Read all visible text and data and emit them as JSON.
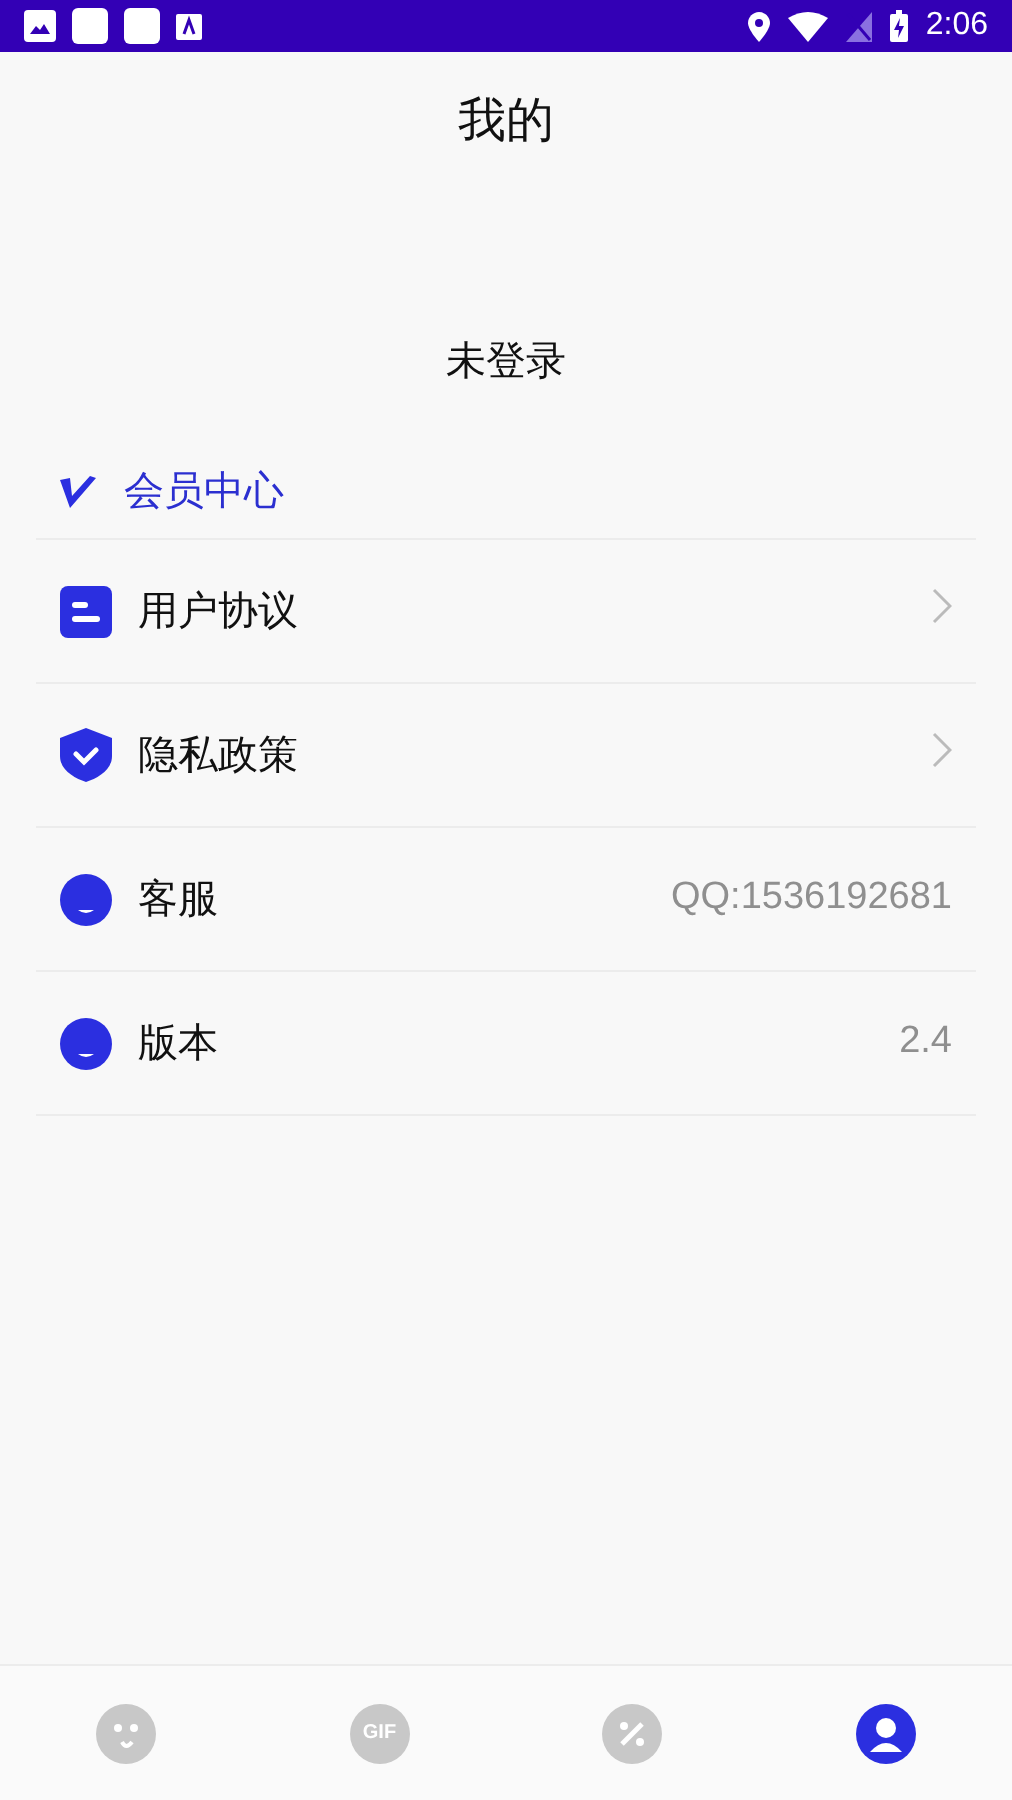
{
  "status_bar": {
    "time": "2:06"
  },
  "header": {
    "title": "我的"
  },
  "profile": {
    "login_status": "未登录"
  },
  "member": {
    "label": "会员中心"
  },
  "rows": [
    {
      "kind": "link",
      "label": "用户协议"
    },
    {
      "kind": "link",
      "label": "隐私政策"
    },
    {
      "kind": "info",
      "label": "客服",
      "value": "QQ:1536192681"
    },
    {
      "kind": "info",
      "label": "版本",
      "value": "2.4"
    }
  ],
  "bottom_nav": [
    {
      "kind": "face",
      "selected": false
    },
    {
      "kind": "gif",
      "text": "GIF",
      "selected": false
    },
    {
      "kind": "percent",
      "selected": false
    },
    {
      "kind": "profile",
      "selected": true
    }
  ]
}
